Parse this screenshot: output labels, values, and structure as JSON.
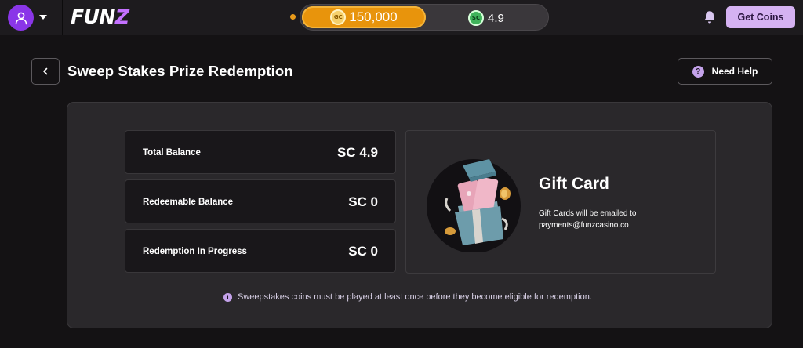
{
  "header": {
    "logo_main": "FUN",
    "logo_accent": "Z",
    "gold_coins": {
      "badge": "GC",
      "amount": "150,000"
    },
    "sweeps_coins": {
      "badge": "SC",
      "amount": "4.9"
    },
    "get_coins_label": "Get Coins",
    "icons": {
      "avatar": "user-icon",
      "menu": "caret-down-icon",
      "notifications": "bell-icon"
    }
  },
  "page": {
    "title": "Sweep Stakes Prize Redemption",
    "help_label": "Need Help",
    "help_glyph": "?"
  },
  "balances": [
    {
      "label": "Total Balance",
      "value": "SC 4.9"
    },
    {
      "label": "Redeemable Balance",
      "value": "SC 0"
    },
    {
      "label": "Redemption In Progress",
      "value": "SC 0"
    }
  ],
  "gift_card": {
    "title": "Gift Card",
    "description": "Gift Cards will be emailed to payments@funzcasino.co"
  },
  "notice": {
    "glyph": "i",
    "text": "Sweepstakes coins must be played at least once before they become eligible for redemption."
  },
  "colors": {
    "accent": "#d5b2f2",
    "gold": "#e8940c",
    "avatar": "#8a36e8",
    "background": "#141214",
    "card": "#2a282b"
  }
}
